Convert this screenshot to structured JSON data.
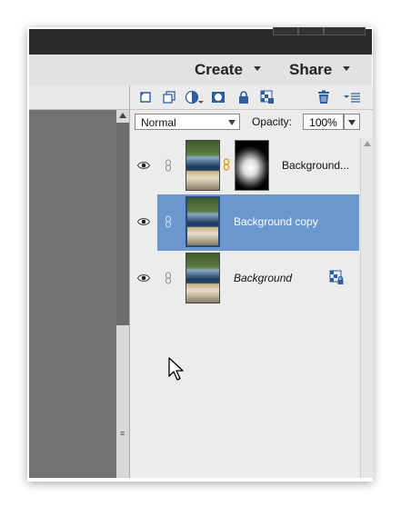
{
  "header": {
    "create_label": "Create",
    "share_label": "Share"
  },
  "layers_panel": {
    "toolbar_icons": [
      "new-layer-icon",
      "new-group-icon",
      "adjustment-layer-icon",
      "add-mask-icon",
      "lock-icon",
      "lock-transparency-icon",
      "delete-icon",
      "panel-menu-icon"
    ],
    "blend_mode": "Normal",
    "opacity_label": "Opacity:",
    "opacity_value": "100%",
    "layers": [
      {
        "name": "Background...",
        "visible": true,
        "has_mask": true,
        "selected": false,
        "locked": false
      },
      {
        "name": "Background copy",
        "visible": true,
        "has_mask": false,
        "selected": true,
        "locked": false
      },
      {
        "name": "Background",
        "visible": true,
        "has_mask": false,
        "selected": false,
        "locked": true
      }
    ]
  },
  "colors": {
    "selected_row": "#6b97cf",
    "panel_bg": "#ececec",
    "canvas_bg": "#737373",
    "topbar": "#2b2b2b"
  }
}
